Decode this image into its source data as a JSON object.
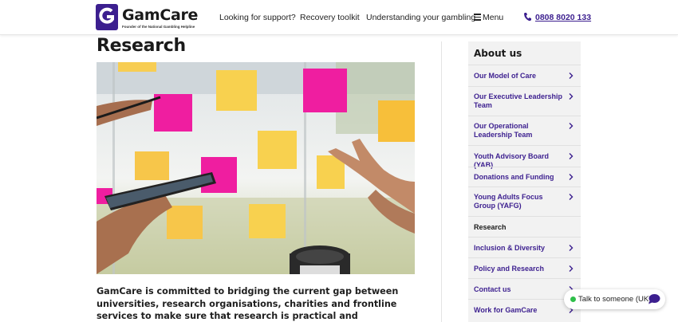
{
  "header": {
    "logo_text": "GamCare",
    "logo_tagline": "Founder of the National Gambling Helpline",
    "nav": [
      {
        "label": "Looking for support?"
      },
      {
        "label": "Recovery toolkit"
      },
      {
        "label": "Understanding your gambling"
      }
    ],
    "menu_label": "Menu",
    "phone": "0808 8020 133"
  },
  "main": {
    "title": "Research",
    "image_alt": "Hands holding a phone and pen in front of sticky notes on glass",
    "intro": "GamCare is committed to bridging the current gap between universities, research organisations, charities and frontline services to make sure that research is practical and applicable."
  },
  "sidebar": {
    "title": "About us",
    "items": [
      {
        "label": "Our Model of Care",
        "active": false
      },
      {
        "label": "Our Executive Leadership Team",
        "active": false
      },
      {
        "label": "Our Operational Leadership Team",
        "active": false
      },
      {
        "label": "Youth Advisory Board (YAB)",
        "active": false
      },
      {
        "label": "Donations and Funding",
        "active": false
      },
      {
        "label": "Young Adults Focus Group (YAFG)",
        "active": false
      },
      {
        "label": "Research",
        "active": true
      },
      {
        "label": "Inclusion & Diversity",
        "active": false
      },
      {
        "label": "Policy and Research",
        "active": false
      },
      {
        "label": "Contact us",
        "active": false
      },
      {
        "label": "Work for GamCare",
        "active": false
      }
    ]
  },
  "chat": {
    "label": "Talk to someone (UK)"
  },
  "colors": {
    "brand_purple": "#3c1f8f",
    "online_green": "#2fbf4a",
    "sidebar_bg": "#f2f2f2"
  },
  "icons": [
    "gamcare-logo-icon",
    "menu-icon",
    "phone-icon",
    "chevron-right-icon",
    "chat-bubble-icon"
  ]
}
